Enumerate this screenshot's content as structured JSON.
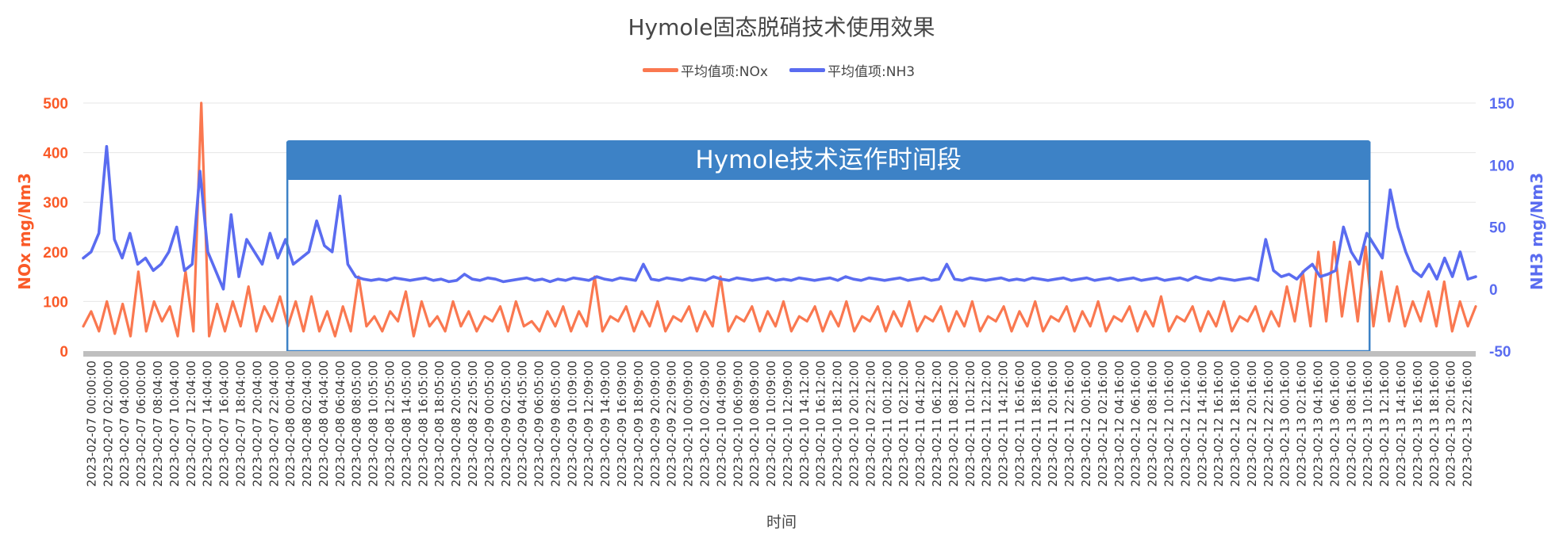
{
  "chart_data": {
    "type": "line",
    "title": "Hymole固态脱硝技术使用效果",
    "xlabel": "时间",
    "ylabel_left": "NOx mg/Nm3",
    "ylabel_right": "NH3 mg/Nm3",
    "ylim_left": [
      0,
      500
    ],
    "yticks_left": [
      0,
      100,
      200,
      300,
      400,
      500
    ],
    "ylim_right": [
      -50,
      150
    ],
    "yticks_right": [
      -50,
      0,
      50,
      100,
      150
    ],
    "grid": true,
    "legend_position": "top-center",
    "annotation": "Hymole技术运作时间段",
    "annotation_range": [
      "2023-02-08 00:04:00",
      "2023-02-13 10:16:00"
    ],
    "x_ticks": [
      "2023-02-07 00:00:00",
      "2023-02-07 02:00:00",
      "2023-02-07 04:00:00",
      "2023-02-07 06:00:00",
      "2023-02-07 08:04:00",
      "2023-02-07 10:04:00",
      "2023-02-07 12:04:00",
      "2023-02-07 14:04:00",
      "2023-02-07 16:04:00",
      "2023-02-07 18:04:00",
      "2023-02-07 20:04:00",
      "2023-02-07 22:04:00",
      "2023-02-08 00:04:00",
      "2023-02-08 02:04:00",
      "2023-02-08 04:04:00",
      "2023-02-08 06:04:00",
      "2023-02-08 08:05:00",
      "2023-02-08 10:05:00",
      "2023-02-08 12:05:00",
      "2023-02-08 14:05:00",
      "2023-02-08 16:05:00",
      "2023-02-08 18:05:00",
      "2023-02-08 20:05:00",
      "2023-02-08 22:05:00",
      "2023-02-09 00:05:00",
      "2023-02-09 02:05:00",
      "2023-02-09 04:05:00",
      "2023-02-09 06:05:00",
      "2023-02-09 08:05:00",
      "2023-02-09 10:09:00",
      "2023-02-09 12:09:00",
      "2023-02-09 14:09:00",
      "2023-02-09 16:09:00",
      "2023-02-09 18:09:00",
      "2023-02-09 20:09:00",
      "2023-02-09 22:09:00",
      "2023-02-10 00:09:00",
      "2023-02-10 02:09:00",
      "2023-02-10 04:09:00",
      "2023-02-10 06:09:00",
      "2023-02-10 08:09:00",
      "2023-02-10 10:09:00",
      "2023-02-10 12:09:00",
      "2023-02-10 14:12:00",
      "2023-02-10 16:12:00",
      "2023-02-10 18:12:00",
      "2023-02-10 20:12:00",
      "2023-02-10 22:12:00",
      "2023-02-11 00:12:00",
      "2023-02-11 02:12:00",
      "2023-02-11 04:12:00",
      "2023-02-11 06:12:00",
      "2023-02-11 08:12:00",
      "2023-02-11 10:12:00",
      "2023-02-11 12:12:00",
      "2023-02-11 14:12:00",
      "2023-02-11 16:16:00",
      "2023-02-11 18:16:00",
      "2023-02-11 20:16:00",
      "2023-02-11 22:16:00",
      "2023-02-12 00:16:00",
      "2023-02-12 02:16:00",
      "2023-02-12 04:16:00",
      "2023-02-12 06:16:00",
      "2023-02-12 08:16:00",
      "2023-02-12 10:16:00",
      "2023-02-12 12:16:00",
      "2023-02-12 14:16:00",
      "2023-02-12 16:16:00",
      "2023-02-12 18:16:00",
      "2023-02-12 20:16:00",
      "2023-02-12 22:16:00",
      "2023-02-13 00:16:00",
      "2023-02-13 02:16:00",
      "2023-02-13 04:16:00",
      "2023-02-13 06:16:00",
      "2023-02-13 08:16:00",
      "2023-02-13 10:16:00",
      "2023-02-13 12:16:00",
      "2023-02-13 14:16:00",
      "2023-02-13 16:16:00",
      "2023-02-13 18:16:00",
      "2023-02-13 20:16:00",
      "2023-02-13 22:16:00"
    ],
    "series": [
      {
        "name": "平均值项:NOx",
        "axis": "left",
        "color": "#fa7850",
        "values": [
          50,
          80,
          40,
          100,
          35,
          95,
          30,
          160,
          40,
          100,
          60,
          90,
          30,
          160,
          40,
          500,
          30,
          95,
          40,
          100,
          50,
          130,
          40,
          90,
          60,
          110,
          50,
          100,
          40,
          110,
          40,
          80,
          30,
          90,
          40,
          150,
          50,
          70,
          40,
          80,
          60,
          120,
          30,
          100,
          50,
          70,
          40,
          100,
          50,
          80,
          40,
          70,
          60,
          90,
          40,
          100,
          50,
          60,
          40,
          80,
          50,
          90,
          40,
          80,
          50,
          150,
          40,
          70,
          60,
          90,
          40,
          80,
          50,
          100,
          40,
          70,
          60,
          90,
          40,
          80,
          50,
          150,
          40,
          70,
          60,
          90,
          40,
          80,
          50,
          100,
          40,
          70,
          60,
          90,
          40,
          80,
          50,
          100,
          40,
          70,
          60,
          90,
          40,
          80,
          50,
          100,
          40,
          70,
          60,
          90,
          40,
          80,
          50,
          100,
          40,
          70,
          60,
          90,
          40,
          80,
          50,
          100,
          40,
          70,
          60,
          90,
          40,
          80,
          50,
          100,
          40,
          70,
          60,
          90,
          40,
          80,
          50,
          110,
          40,
          70,
          60,
          90,
          40,
          80,
          50,
          100,
          40,
          70,
          60,
          90,
          40,
          80,
          50,
          130,
          60,
          160,
          50,
          200,
          60,
          220,
          70,
          180,
          60,
          210,
          50,
          160,
          60,
          130,
          50,
          100,
          60,
          120,
          50,
          140,
          40,
          100,
          50,
          90
        ]
      },
      {
        "name": "平均值项:NH3",
        "axis": "right",
        "color": "#5a6cf0",
        "values": [
          25,
          30,
          45,
          115,
          40,
          25,
          45,
          20,
          25,
          15,
          20,
          30,
          50,
          15,
          20,
          95,
          30,
          15,
          0,
          60,
          10,
          40,
          30,
          20,
          45,
          25,
          40,
          20,
          25,
          30,
          55,
          35,
          30,
          75,
          20,
          10,
          8,
          7,
          8,
          7,
          9,
          8,
          7,
          8,
          9,
          7,
          8,
          6,
          7,
          12,
          8,
          7,
          9,
          8,
          6,
          7,
          8,
          9,
          7,
          8,
          6,
          8,
          7,
          9,
          8,
          7,
          10,
          8,
          7,
          9,
          8,
          7,
          20,
          8,
          7,
          9,
          8,
          7,
          9,
          8,
          7,
          10,
          8,
          7,
          9,
          8,
          7,
          8,
          9,
          7,
          8,
          7,
          9,
          8,
          7,
          8,
          9,
          7,
          10,
          8,
          7,
          9,
          8,
          7,
          8,
          9,
          7,
          8,
          9,
          7,
          8,
          20,
          8,
          7,
          9,
          8,
          7,
          8,
          9,
          7,
          8,
          7,
          9,
          8,
          7,
          8,
          9,
          7,
          8,
          9,
          7,
          8,
          9,
          7,
          8,
          9,
          7,
          8,
          9,
          7,
          8,
          9,
          7,
          10,
          8,
          7,
          9,
          8,
          7,
          8,
          9,
          7,
          40,
          15,
          10,
          12,
          8,
          15,
          20,
          10,
          12,
          15,
          50,
          30,
          20,
          45,
          35,
          25,
          80,
          50,
          30,
          15,
          10,
          20,
          8,
          25,
          10,
          30,
          8,
          10
        ]
      }
    ]
  }
}
